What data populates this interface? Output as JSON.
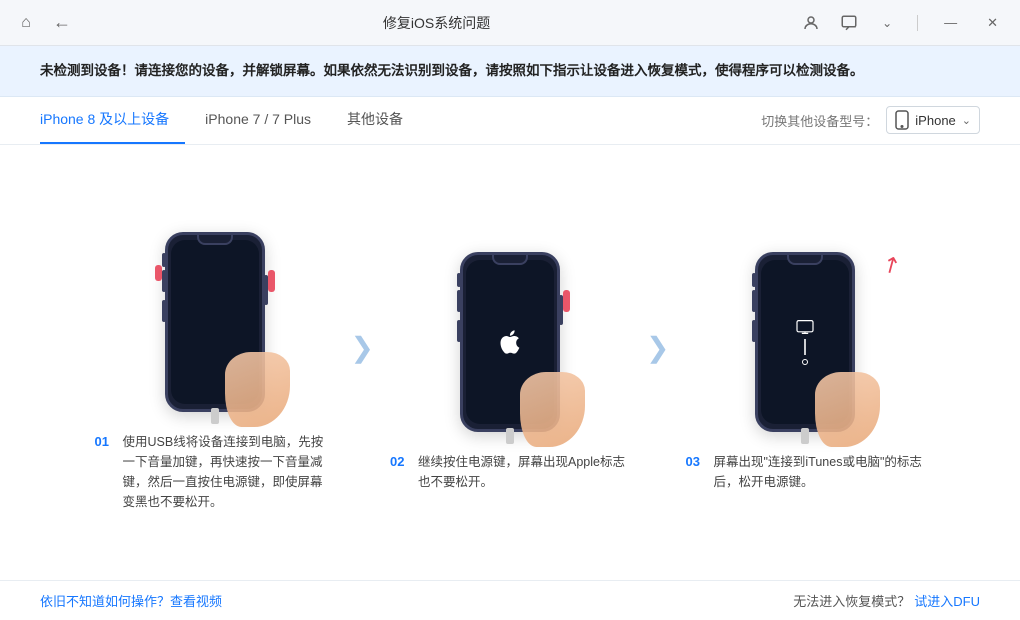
{
  "titlebar": {
    "title": "修复iOS系统问题",
    "home_label": "🏠",
    "back_label": "←",
    "chat_label": "💬",
    "dropdown_label": "∨",
    "minimize_label": "—",
    "close_label": "✕"
  },
  "alert": {
    "text": "未检测到设备！请连接您的设备，并解锁屏幕。如果依然无法识别到设备，请按照如下指示让设备进入恢复模式，使得程序可以检测设备。"
  },
  "tabs": [
    {
      "id": "tab-iphone8",
      "label": "iPhone 8 及以上设备",
      "active": true
    },
    {
      "id": "tab-iphone7",
      "label": "iPhone 7 / 7 Plus",
      "active": false
    },
    {
      "id": "tab-other",
      "label": "其他设备",
      "active": false
    }
  ],
  "device_switcher": {
    "label": "切换其他设备型号：",
    "device": "iPhone"
  },
  "steps": [
    {
      "num": "01",
      "desc": "使用USB线将设备连接到电脑，先按一下音量加键，再快速按一下音量减键，然后一直按住电源键，即使屏幕变黑也不要松开。"
    },
    {
      "num": "02",
      "desc": "继续按住电源键，屏幕出现Apple标志也不要松开。"
    },
    {
      "num": "03",
      "desc": "屏幕出现\"连接到iTunes或电脑\"的标志后，松开电源键。"
    }
  ],
  "bottom": {
    "help_text": "依旧不知道如何操作？查看视频",
    "no_recovery_text": "无法进入恢复模式？",
    "try_dfu_text": "试进入DFU"
  }
}
